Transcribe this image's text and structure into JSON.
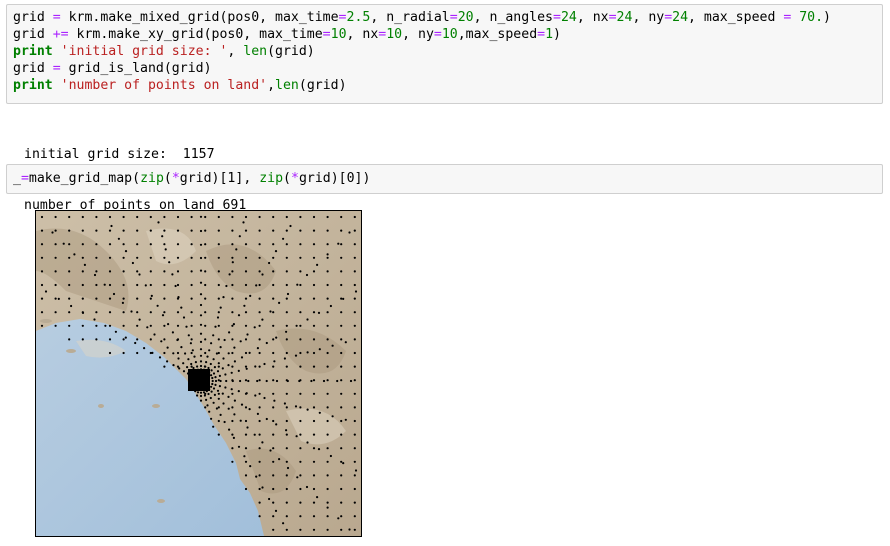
{
  "cell1": {
    "lines": [
      [
        [
          "plain",
          "grid "
        ],
        [
          "op",
          "="
        ],
        [
          "plain",
          " krm.make_mixed_grid(pos0, max_time"
        ],
        [
          "op",
          "="
        ],
        [
          "num",
          "2.5"
        ],
        [
          "plain",
          ", n_radial"
        ],
        [
          "op",
          "="
        ],
        [
          "num",
          "20"
        ],
        [
          "plain",
          ", n_angles"
        ],
        [
          "op",
          "="
        ],
        [
          "num",
          "24"
        ],
        [
          "plain",
          ", nx"
        ],
        [
          "op",
          "="
        ],
        [
          "num",
          "24"
        ],
        [
          "plain",
          ", ny"
        ],
        [
          "op",
          "="
        ],
        [
          "num",
          "24"
        ],
        [
          "plain",
          ", max_speed "
        ],
        [
          "op",
          "="
        ],
        [
          "num",
          " 70."
        ],
        [
          "plain",
          ")"
        ]
      ],
      [
        [
          "plain",
          "grid "
        ],
        [
          "op",
          "+="
        ],
        [
          "plain",
          " krm.make_xy_grid(pos0, max_time"
        ],
        [
          "op",
          "="
        ],
        [
          "num",
          "10"
        ],
        [
          "plain",
          ", nx"
        ],
        [
          "op",
          "="
        ],
        [
          "num",
          "10"
        ],
        [
          "plain",
          ", ny"
        ],
        [
          "op",
          "="
        ],
        [
          "num",
          "10"
        ],
        [
          "plain",
          ",max_speed"
        ],
        [
          "op",
          "="
        ],
        [
          "num",
          "1"
        ],
        [
          "plain",
          ")"
        ]
      ],
      [
        [
          "kw",
          "print"
        ],
        [
          "plain",
          " "
        ],
        [
          "str",
          "'initial grid size: '"
        ],
        [
          "plain",
          ", "
        ],
        [
          "fn",
          "len"
        ],
        [
          "plain",
          "(grid)"
        ]
      ],
      [
        [
          "plain",
          "grid "
        ],
        [
          "op",
          "="
        ],
        [
          "plain",
          " grid_is_land(grid)"
        ]
      ],
      [
        [
          "kw",
          "print"
        ],
        [
          "plain",
          " "
        ],
        [
          "str",
          "'number of points on land'"
        ],
        [
          "plain",
          ","
        ],
        [
          "fn",
          "len"
        ],
        [
          "plain",
          "(grid)"
        ]
      ]
    ]
  },
  "output1": {
    "lines": [
      "initial grid size:  1157",
      "number of points on land 691"
    ]
  },
  "cell2": {
    "lines": [
      [
        [
          "plain",
          "_"
        ],
        [
          "op",
          "="
        ],
        [
          "plain",
          "make_grid_map("
        ],
        [
          "fn",
          "zip"
        ],
        [
          "plain",
          "("
        ],
        [
          "op",
          "*"
        ],
        [
          "plain",
          "grid)[1], "
        ],
        [
          "fn",
          "zip"
        ],
        [
          "plain",
          "("
        ],
        [
          "op",
          "*"
        ],
        [
          "plain",
          "grid)[0])"
        ]
      ]
    ]
  },
  "map": {
    "land_color": "#c8b8a0",
    "ocean_color": "#a9c4dc",
    "dot_color": "#000000"
  }
}
